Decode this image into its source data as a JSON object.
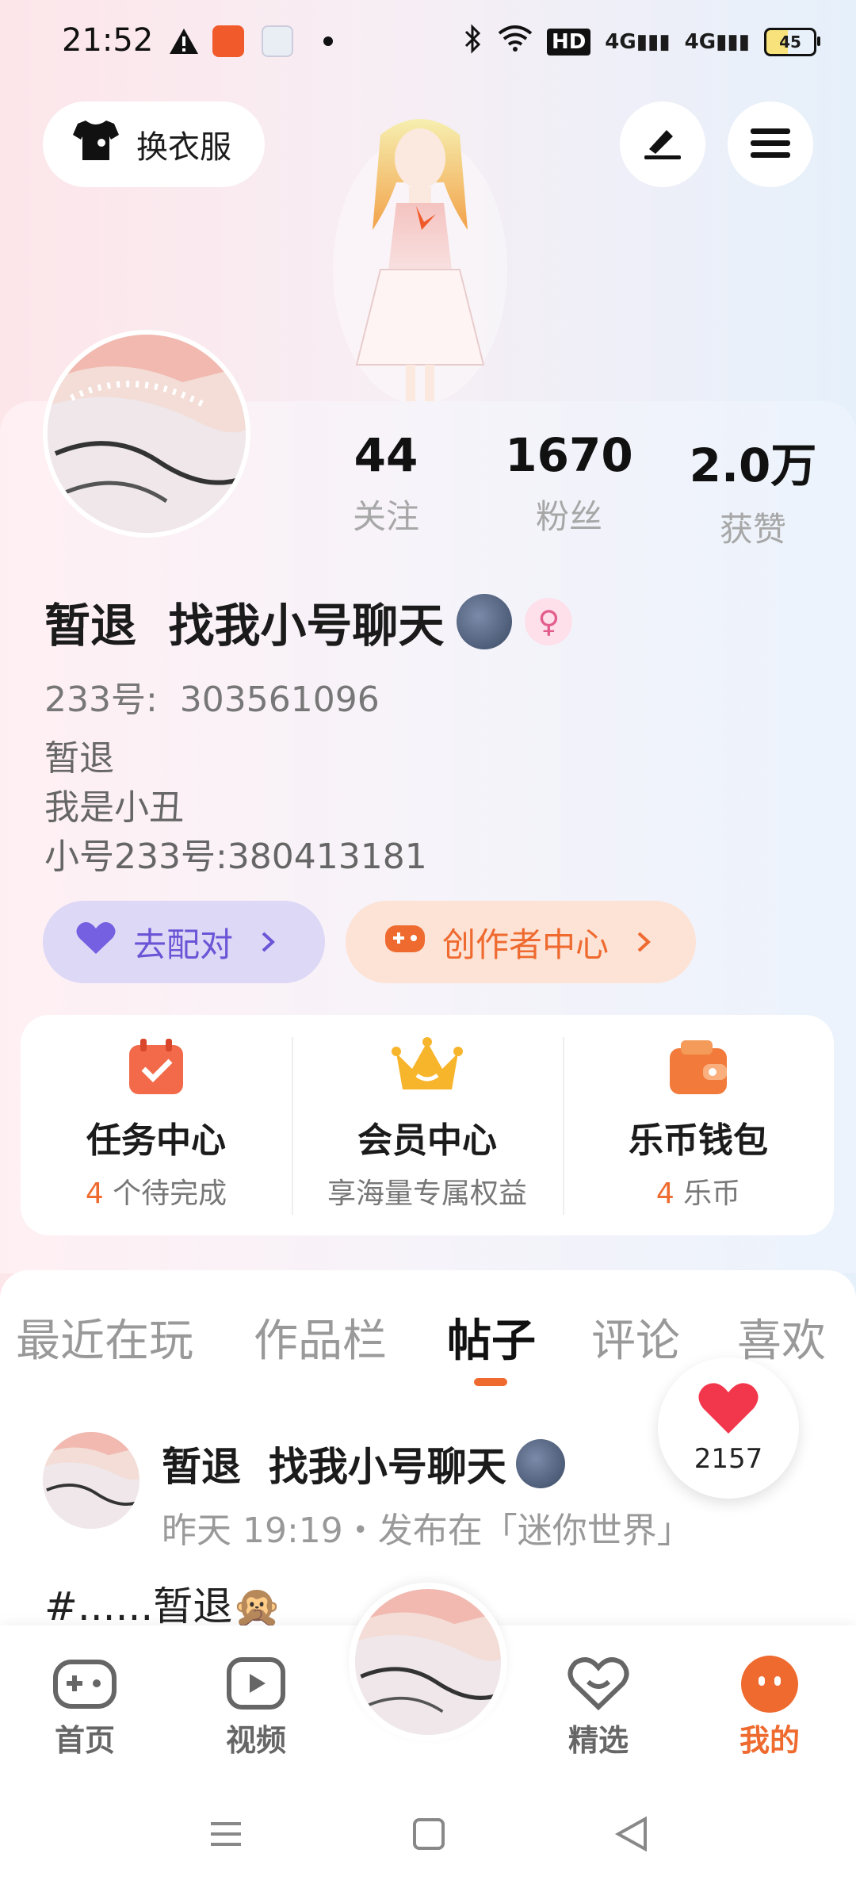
{
  "status_bar": {
    "time": "21:52",
    "battery": "45",
    "icons": [
      "warning-icon",
      "app-notification-icon",
      "map-notification-icon",
      "dot-icon",
      "bluetooth-icon",
      "wifi-icon",
      "hd-icon",
      "signal-4g-icon",
      "signal-4g-icon",
      "battery-icon"
    ]
  },
  "header": {
    "dress_button": "换衣服",
    "edit_icon": "edit-icon",
    "menu_icon": "menu-icon"
  },
  "profile": {
    "stats": [
      {
        "value": "44",
        "label": "关注"
      },
      {
        "value": "1670",
        "label": "粉丝"
      },
      {
        "value": "2.0万",
        "label": "获赞"
      }
    ],
    "name": "暂退  找我小号聊天",
    "uid": "233号:  303561096",
    "bio": [
      "暂退",
      "我是小丑",
      "小号233号:380413181"
    ],
    "match_button": "去配对",
    "creator_button": "创作者中心"
  },
  "quick": [
    {
      "title": "任务中心",
      "count": "4",
      "sub": " 个待完成",
      "icon": "calendar-check-icon",
      "color": "#f26a4a"
    },
    {
      "title": "会员中心",
      "count": "",
      "sub": "享海量专属权益",
      "icon": "crown-icon",
      "color": "#f7b52c"
    },
    {
      "title": "乐币钱包",
      "count": "4",
      "sub": " 乐币",
      "icon": "wallet-icon",
      "color": "#f27a3a"
    }
  ],
  "tabs": [
    "最近在玩",
    "作品栏",
    "帖子",
    "评论",
    "喜欢"
  ],
  "active_tab": "帖子",
  "post": {
    "author": "暂退  找我小号聊天",
    "meta": "昨天 19:19・发布在「迷你世界」",
    "text": "#......暂退🙊"
  },
  "likes": "2157",
  "bottom_nav": [
    {
      "label": "首页",
      "icon": "gamepad-icon"
    },
    {
      "label": "视频",
      "icon": "video-icon"
    },
    {
      "label": "精选",
      "icon": "heart-icon"
    },
    {
      "label": "我的",
      "icon": "me-icon"
    }
  ],
  "colors": {
    "accent": "#ee6a2f",
    "purple": "#6b55d6"
  }
}
